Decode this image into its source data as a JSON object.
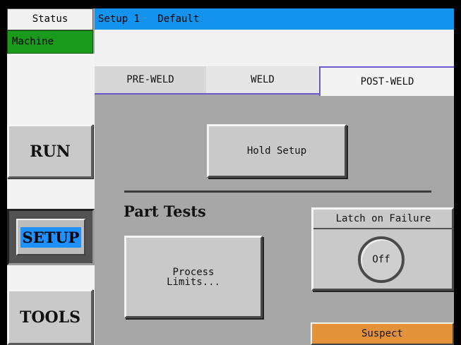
{
  "status": {
    "status_label": "Status",
    "machine_label": "Machine",
    "machine_color": "#1a9a1a"
  },
  "header": {
    "title": "Setup 1   Default",
    "bar_color": "#1493ee"
  },
  "tabs": [
    {
      "label": "PRE-WELD"
    },
    {
      "label": "WELD"
    },
    {
      "label": "POST-WELD",
      "active": true
    }
  ],
  "sidebar": {
    "run_label": "RUN",
    "setup_label": "SETUP",
    "tools_label": "TOOLS",
    "active": "SETUP"
  },
  "main": {
    "hold_setup_label": "Hold Setup",
    "part_tests_heading": "Part Tests",
    "process_limits_line1": "Process",
    "process_limits_line2": "Limits...",
    "latch": {
      "title": "Latch on Failure",
      "value": "Off"
    },
    "suspect_label": "Suspect",
    "suspect_color": "#e3923a"
  }
}
